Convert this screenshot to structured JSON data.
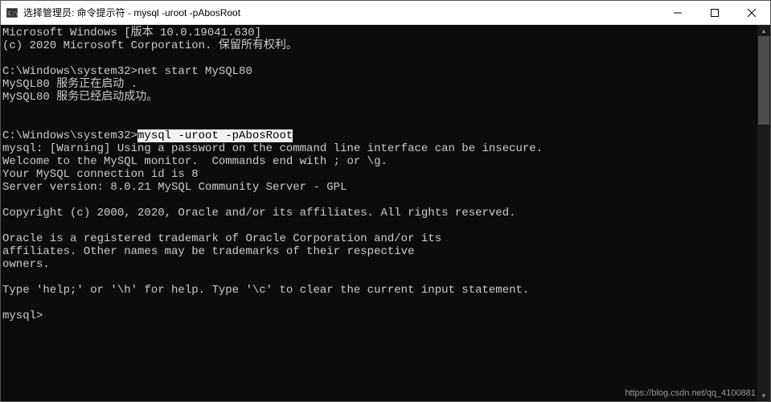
{
  "window": {
    "title": "选择管理员: 命令提示符 - mysql  -uroot -pAbosRoot"
  },
  "terminal": {
    "lines": [
      {
        "text": "Microsoft Windows [版本 10.0.19041.630]"
      },
      {
        "text": "(c) 2020 Microsoft Corporation. 保留所有权利。"
      },
      {
        "text": ""
      },
      {
        "text": "C:\\Windows\\system32>net start MySQL80"
      },
      {
        "text": "MySQL80 服务正在启动 ."
      },
      {
        "text": "MySQL80 服务已经启动成功。"
      },
      {
        "text": ""
      },
      {
        "text": ""
      },
      {
        "prefix": "C:\\Windows\\system32>",
        "hl": "mysql -uroot -pAbosRoot"
      },
      {
        "text": "mysql: [Warning] Using a password on the command line interface can be insecure."
      },
      {
        "text": "Welcome to the MySQL monitor.  Commands end with ; or \\g."
      },
      {
        "text": "Your MySQL connection id is 8"
      },
      {
        "text": "Server version: 8.0.21 MySQL Community Server - GPL"
      },
      {
        "text": ""
      },
      {
        "text": "Copyright (c) 2000, 2020, Oracle and/or its affiliates. All rights reserved."
      },
      {
        "text": ""
      },
      {
        "text": "Oracle is a registered trademark of Oracle Corporation and/or its"
      },
      {
        "text": "affiliates. Other names may be trademarks of their respective"
      },
      {
        "text": "owners."
      },
      {
        "text": ""
      },
      {
        "text": "Type 'help;' or '\\h' for help. Type '\\c' to clear the current input statement."
      },
      {
        "text": ""
      },
      {
        "text": "mysql>"
      }
    ]
  },
  "watermark": "https://blog.csdn.net/qq_4100881"
}
